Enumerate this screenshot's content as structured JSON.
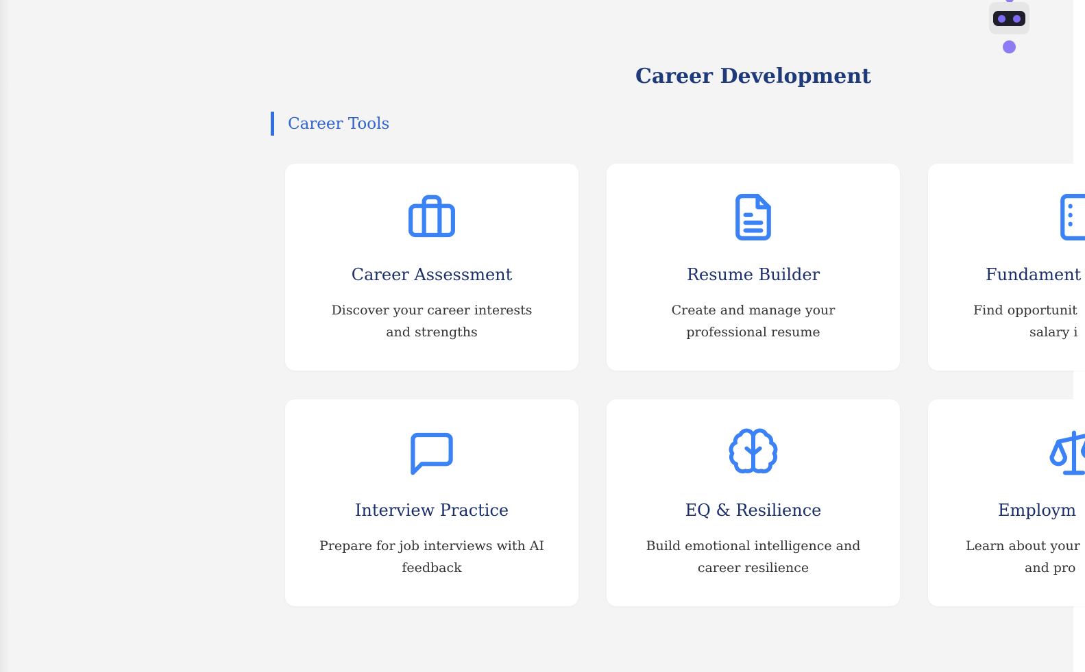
{
  "page": {
    "title": "Career Development",
    "section_title": "Career Tools"
  },
  "colors": {
    "accent": "#3b82f6",
    "title": "#1e3a7b",
    "background": "#f4f4f4",
    "robot": "#8b7cf6"
  },
  "cards": [
    {
      "icon": "briefcase-icon",
      "title": "Career Assessment",
      "description": "Discover your career interests and strengths"
    },
    {
      "icon": "document-icon",
      "title": "Resume Builder",
      "description": "Create and manage your professional resume"
    },
    {
      "icon": "notebook-icon",
      "title": "Fundament",
      "description_line1": "Find opportunit",
      "description_line2": "salary i"
    },
    {
      "icon": "chat-bubble-icon",
      "title": "Interview Practice",
      "description": "Prepare for job interviews with AI feedback"
    },
    {
      "icon": "brain-icon",
      "title": "EQ & Resilience",
      "description": "Build emotional intelligence and career resilience"
    },
    {
      "icon": "scale-icon",
      "title": "Employm",
      "description_line1": "Learn about your",
      "description_line2": "and pro"
    }
  ]
}
